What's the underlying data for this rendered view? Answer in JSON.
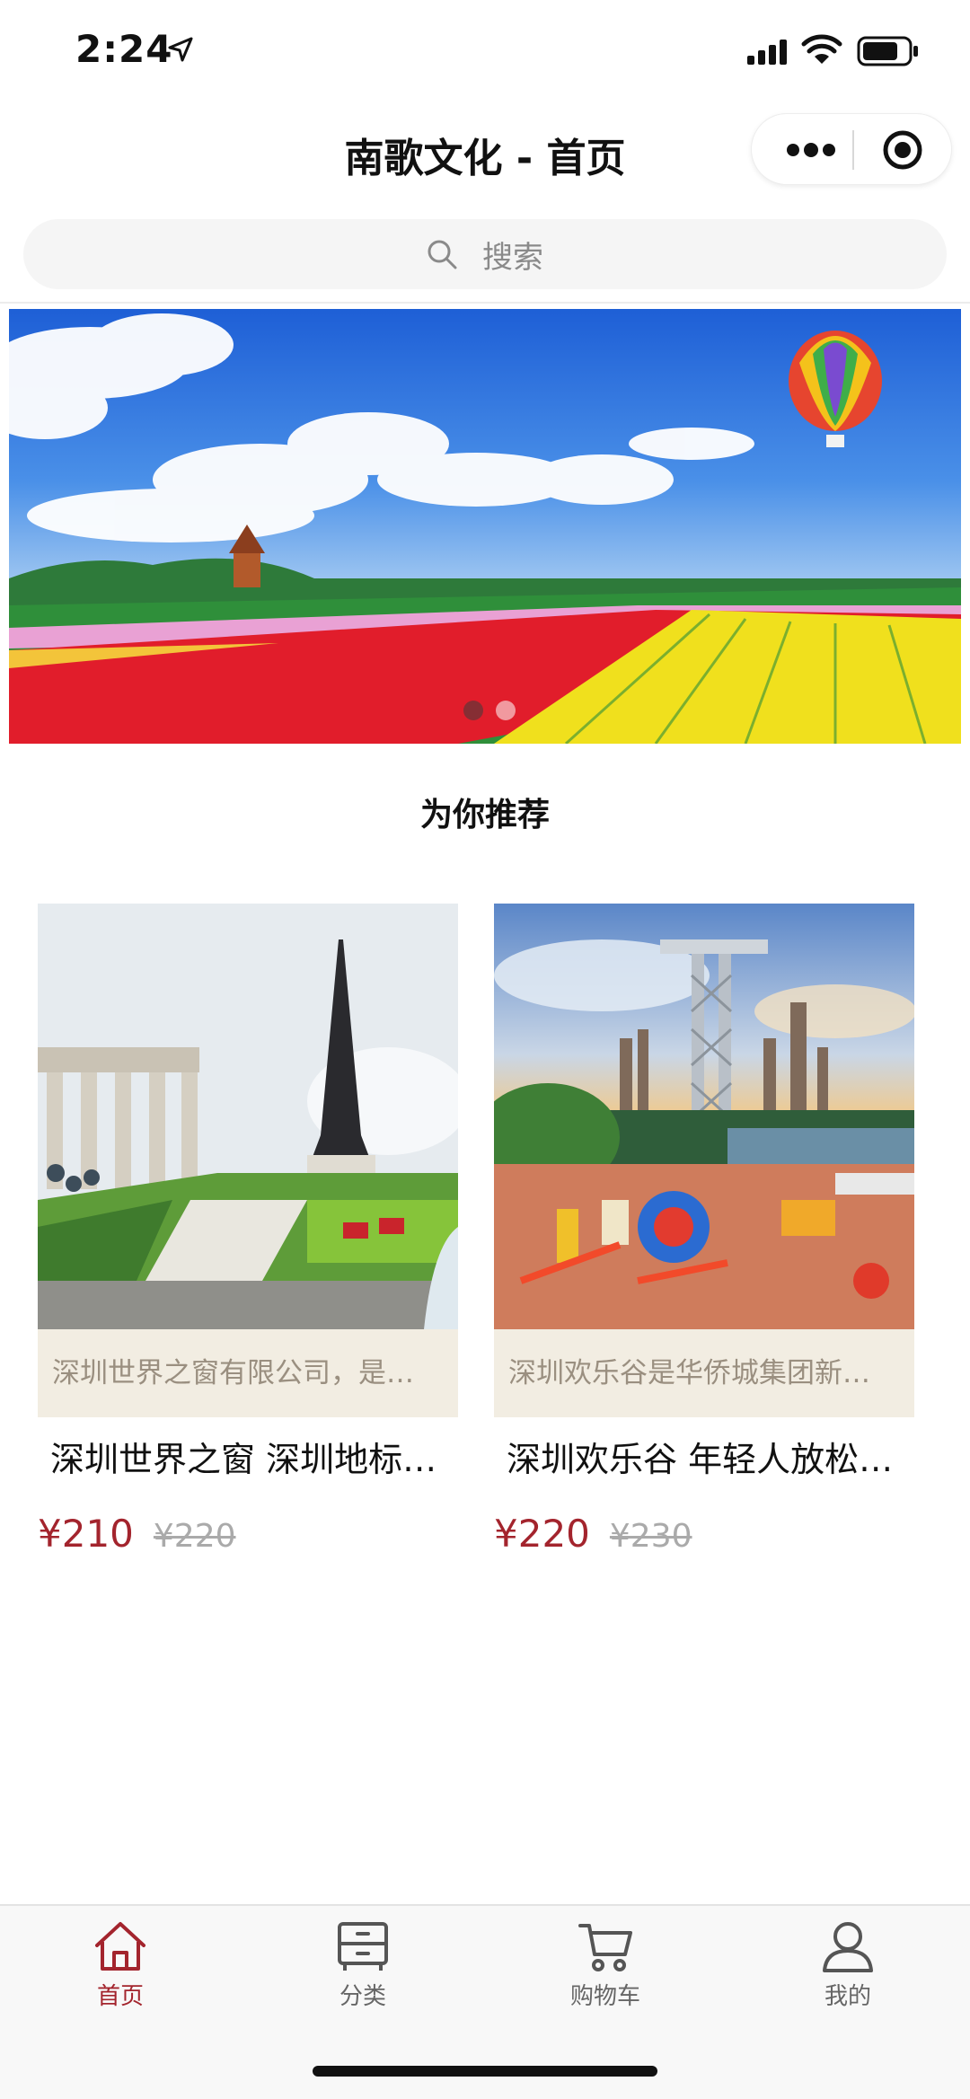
{
  "status_bar": {
    "time": "2:24",
    "icons": [
      "location-arrow-icon",
      "cellular-signal-icon",
      "wifi-icon",
      "battery-icon"
    ]
  },
  "nav": {
    "title": "南歌文化 - 首页",
    "more_icon": "more-dots-icon",
    "close_icon": "miniprogram-close-icon"
  },
  "search": {
    "placeholder": "搜索",
    "icon": "search-icon"
  },
  "banner": {
    "slide_count": 2,
    "active_index": 0
  },
  "recommend": {
    "title": "为你推荐",
    "products": [
      {
        "description": "深圳世界之窗有限公司，是…",
        "name": "深圳世界之窗 深圳地标…",
        "price": "¥210",
        "original_price": "¥220"
      },
      {
        "description": "深圳欢乐谷是华侨城集团新…",
        "name": "深圳欢乐谷 年轻人放松…",
        "price": "¥220",
        "original_price": "¥230"
      }
    ]
  },
  "tab_bar": {
    "active_color": "#a3242d",
    "items": [
      {
        "label": "首页",
        "icon": "home-icon",
        "active": true
      },
      {
        "label": "分类",
        "icon": "category-icon",
        "active": false
      },
      {
        "label": "购物车",
        "icon": "cart-icon",
        "active": false
      },
      {
        "label": "我的",
        "icon": "user-icon",
        "active": false
      }
    ]
  }
}
